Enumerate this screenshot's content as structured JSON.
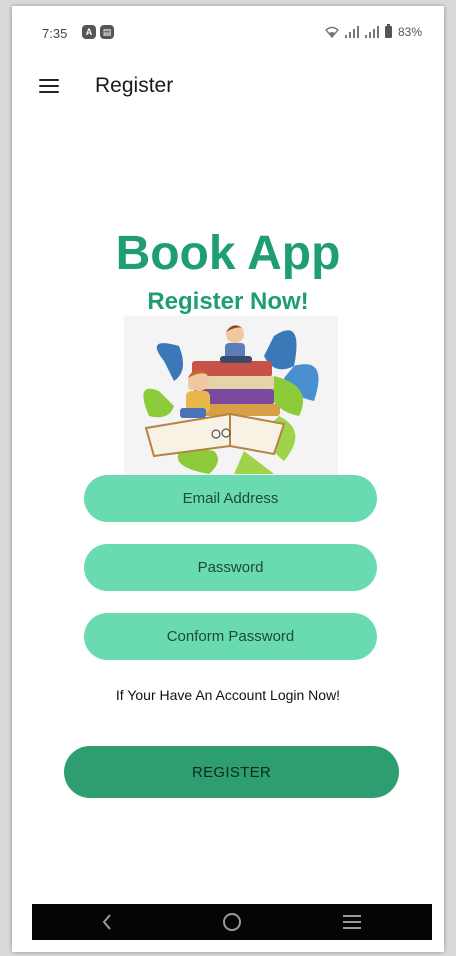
{
  "status_bar": {
    "time": "7:35",
    "battery": "83%",
    "notif_icons": [
      "app-a-icon",
      "app-b-icon"
    ]
  },
  "app_bar": {
    "title": "Register",
    "menu_icon": "hamburger-menu-icon"
  },
  "hero": {
    "title": "Book App",
    "subtitle": "Register Now!"
  },
  "form": {
    "email_placeholder": "Email Address",
    "password_placeholder": "Password",
    "confirm_password_placeholder": "Conform Password",
    "login_prompt": "If Your Have An Account Login Now!",
    "register_label": "REGISTER"
  },
  "nav_bar": {
    "back": "back-icon",
    "home": "home-icon",
    "recents": "recents-icon"
  },
  "colors": {
    "accent": "#1f9e72",
    "input_bg": "#6adbb0",
    "button_bg": "#2e9e70"
  }
}
